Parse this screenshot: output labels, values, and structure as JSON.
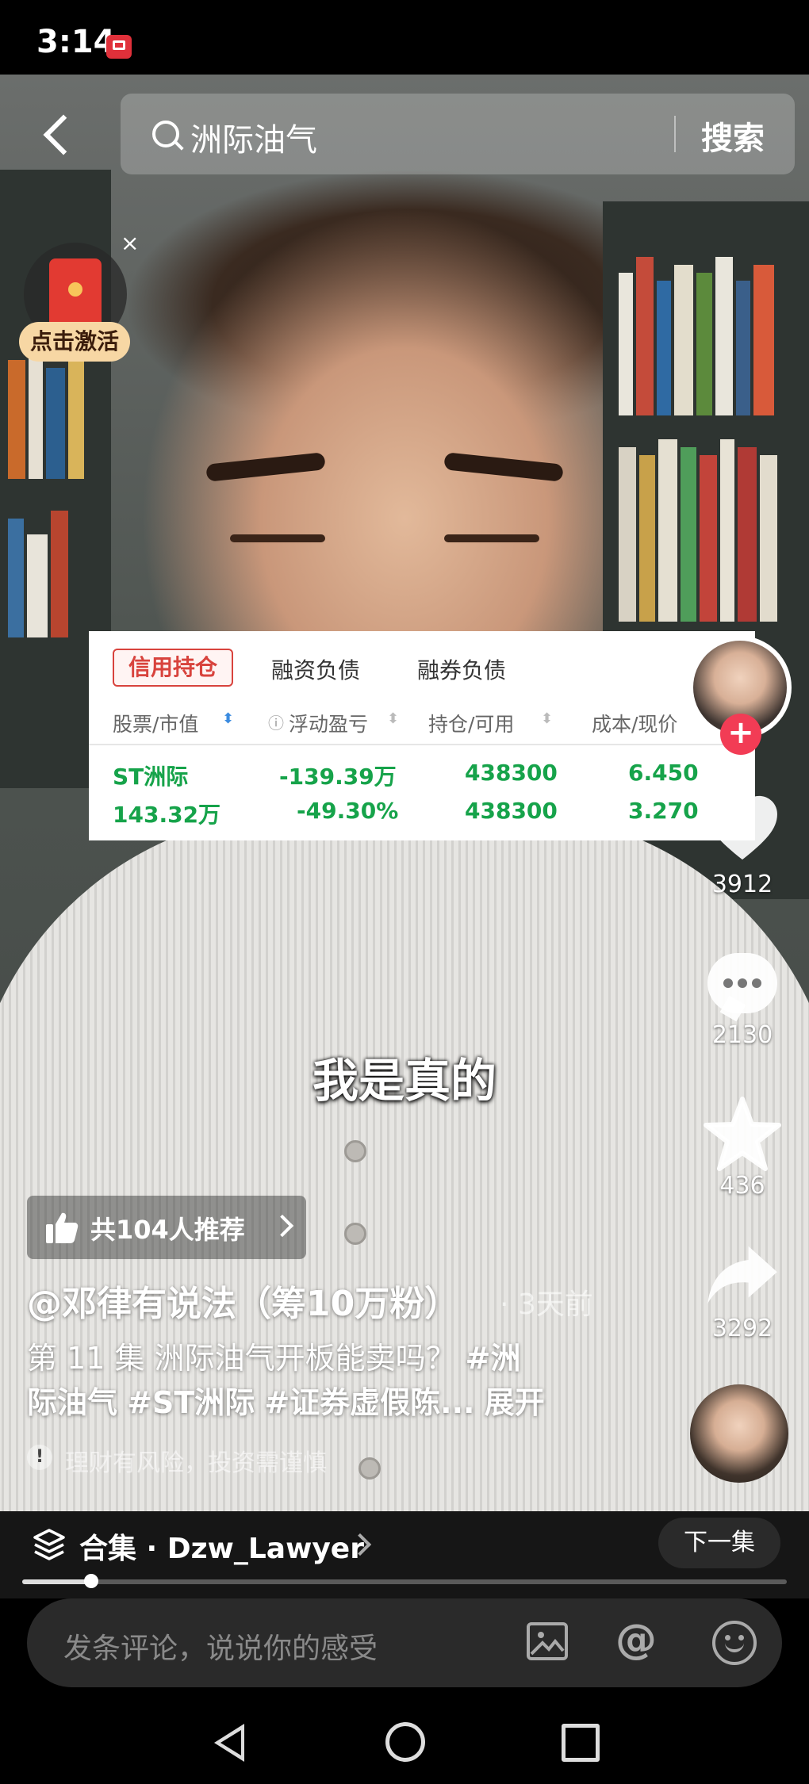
{
  "status_bar": {
    "time": "3:14"
  },
  "search": {
    "query": "洲际油气",
    "button_label": "搜索"
  },
  "red_packet": {
    "close": "×",
    "label": "点击激活"
  },
  "stock_card": {
    "tabs": [
      "信用持仓",
      "融资负债",
      "融券负债"
    ],
    "headers": [
      "股票/市值",
      "浮动盈亏",
      "持仓/可用",
      "成本/现价"
    ],
    "rows": [
      [
        "ST洲际",
        "-139.39万",
        "438300",
        "6.450"
      ],
      [
        "143.32万",
        "-49.30%",
        "438300",
        "3.270"
      ]
    ]
  },
  "sidebar": {
    "follow": "+",
    "likes": "3912",
    "comments": "2130",
    "favorites": "436",
    "shares": "3292"
  },
  "subtitle": "我是真的",
  "recommend": {
    "text": "共104人推荐"
  },
  "video_info": {
    "author": "@邓律有说法（筹10万粉）",
    "time_ago": "· 3天前",
    "desc_line1_prefix": "第 11 集  洲际油气开板能卖吗？ ",
    "desc_tag1": "#洲",
    "desc_line2_tag_cont": "际油气",
    "desc_tag2": "#ST洲际",
    "desc_tag3": "#证券虚假陈...",
    "expand": "展开",
    "risk_notice": "理财有风险，投资需谨慎",
    "risk_icon": "!"
  },
  "collection": {
    "label": "合集 · Dzw_Lawyer",
    "next_button": "下一集",
    "progress": 0.09
  },
  "comment_bar": {
    "placeholder": "发条评论，说说你的感受",
    "at": "@"
  },
  "colors": {
    "follow": "#f23c55",
    "stock_green": "#16a34a",
    "tab_red": "#d8433d"
  }
}
